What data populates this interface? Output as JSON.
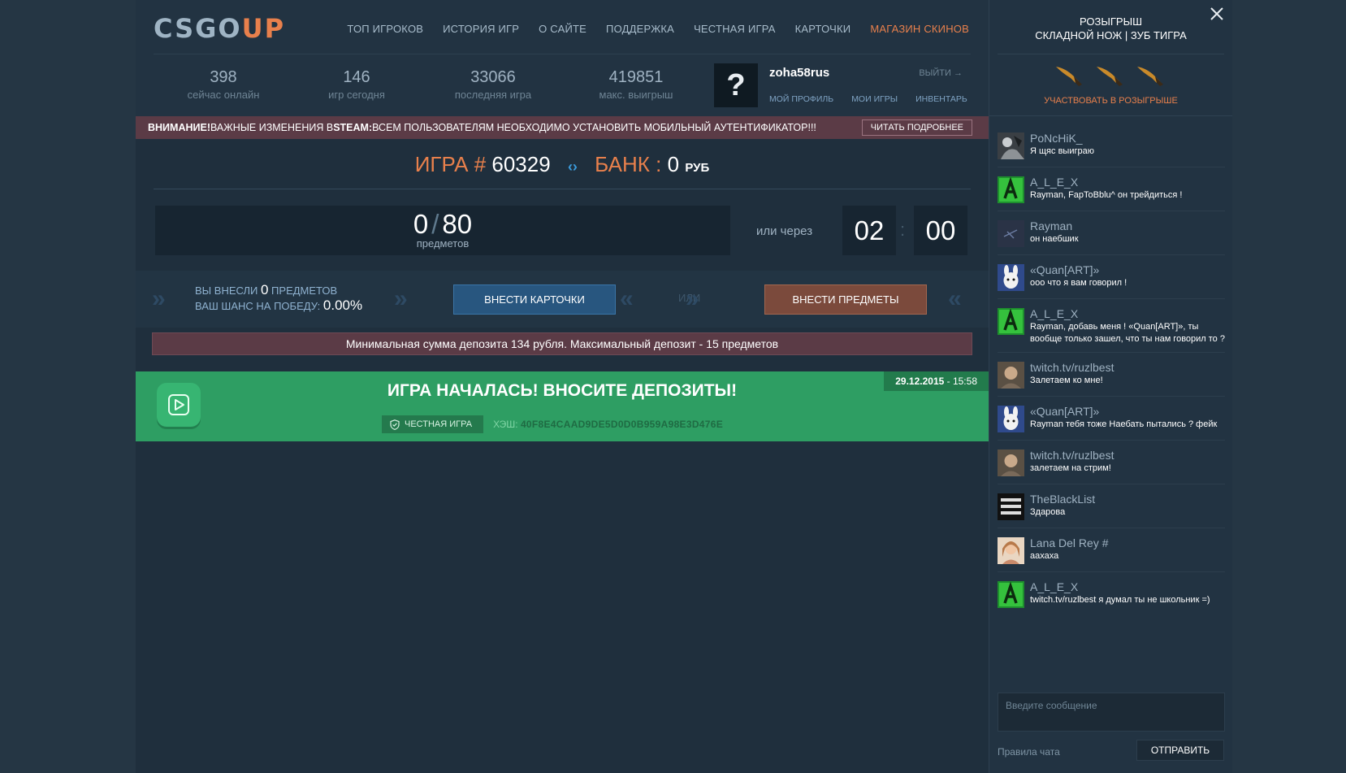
{
  "logo": {
    "part1": "CSGO",
    "part2": "UP"
  },
  "nav": [
    {
      "label": "ТОП ИГРОКОВ"
    },
    {
      "label": "ИСТОРИЯ ИГР"
    },
    {
      "label": "О САЙТЕ"
    },
    {
      "label": "ПОДДЕРЖКА"
    },
    {
      "label": "ЧЕСТНАЯ ИГРА"
    },
    {
      "label": "КАРТОЧКИ"
    },
    {
      "label": "МАГАЗИН СКИНОВ"
    }
  ],
  "stats": [
    {
      "value": "398",
      "label": "сейчас онлайн"
    },
    {
      "value": "146",
      "label": "игр сегодня"
    },
    {
      "value": "33066",
      "label": "последняя игра"
    },
    {
      "value": "419851",
      "label": "макс. выигрыш"
    }
  ],
  "user": {
    "avatar_glyph": "?",
    "name": "zoha58rus",
    "logout": "выйти →",
    "links": {
      "profile": "МОЙ ПРОФИЛЬ",
      "games": "МОИ ИГРЫ",
      "inventory": "ИНВЕНТАРЬ"
    }
  },
  "alert": {
    "lead": "ВНИМАНИЕ!",
    "text1": " ВАЖНЫЕ ИЗМЕНЕНИЯ В ",
    "steam": "STEAM:",
    "text2": " ВСЕМ ПОЛЬЗОВАТЕЛЯМ НЕОБХОДИМО УСТАНОВИТЬ МОБИЛЬНЫЙ АУТЕНТИФИКАТОР!!!",
    "button": "ЧИТАТЬ ПОДРОБНЕЕ"
  },
  "game": {
    "label": "ИГРА",
    "hash_sign": "#",
    "number": "60329",
    "bank_label": "БАНК",
    "colon": ":",
    "bank_value": "0",
    "currency": "РУБ",
    "items_current": "0",
    "slash": "/",
    "items_max": "80",
    "items_label": "предметов",
    "or_via": "или через",
    "timer_min": "02",
    "timer_sep": ":",
    "timer_sec": "00"
  },
  "deposit": {
    "line1_a": "ВЫ ВНЕСЛИ ",
    "line1_count": "0",
    "line1_b": " ПРЕДМЕТОВ",
    "line2_a": "ВАШ ШАНС НА ПОБЕДУ: ",
    "line2_chance": "0.00%",
    "cards_button": "ВНЕСТИ КАРТОЧКИ",
    "or": "ИЛИ",
    "items_button": "ВНЕСТИ ПРЕДМЕТЫ",
    "limits": "Минимальная сумма депозита 134 рубля. Максимальный депозит - 15 предметов"
  },
  "started": {
    "title": "ИГРА НАЧАЛАСЬ! ВНОСИТЕ ДЕПОЗИТЫ!",
    "date": "29.12.2015",
    "time": " - 15:58",
    "fair_label": "ЧЕСТНАЯ ИГРА",
    "hash_label": "ХЭШ: ",
    "hash_value": "40F8E4CAAD9DE5D0D0B959A98E3D476E"
  },
  "raffle": {
    "title1": "РОЗЫГРЫШ",
    "title2": "СКЛАДНОЙ НОЖ | ЗУБ ТИГРА",
    "join": "УЧАСТВОВАТЬ В РОЗЫГРЫШЕ"
  },
  "chat": {
    "messages": [
      {
        "name": "PoNcHiK_",
        "text": "Я щяс выиграю",
        "avatar": "photo-dark"
      },
      {
        "name": "A_L_E_X",
        "text": "Rayman, FapToBblu^ он трейдиться !",
        "avatar": "green-a"
      },
      {
        "name": "Rayman",
        "text": "он наебшик",
        "avatar": "dark-blue"
      },
      {
        "name": "«Quan[ART]»",
        "text": "ооо что я вам говорил !",
        "avatar": "bunny"
      },
      {
        "name": "A_L_E_X",
        "text": "Rayman, добавь меня ! «Quan[ART]», ты вообще только зашел, что ты нам говорил то ?",
        "avatar": "green-a"
      },
      {
        "name": "twitch.tv/ruzlbest",
        "text": "Залетаем ко мне!",
        "avatar": "face"
      },
      {
        "name": "«Quan[ART]»",
        "text": "Rayman тебя тоже Наебать пытались ? фейк",
        "avatar": "bunny"
      },
      {
        "name": "twitch.tv/ruzlbest",
        "text": "залетаем на стрим!",
        "avatar": "face"
      },
      {
        "name": "TheBlackList",
        "text": "Здарова",
        "avatar": "text-logo"
      },
      {
        "name": "Lana Del Rey #",
        "text": "аахаха",
        "avatar": "portrait"
      },
      {
        "name": "A_L_E_X",
        "text": "twitch.tv/ruzlbest я думал ты не школьник =)",
        "avatar": "green-a"
      }
    ],
    "input_placeholder": "Введите сообщение",
    "rules": "Правила чата",
    "send": "ОТПРАВИТЬ"
  },
  "colors": {
    "accent": "#e8804c",
    "green": "#2e9e63",
    "blue_button": "#28567f",
    "brown_button": "#7b4a3c",
    "alert": "#5b3b46"
  }
}
